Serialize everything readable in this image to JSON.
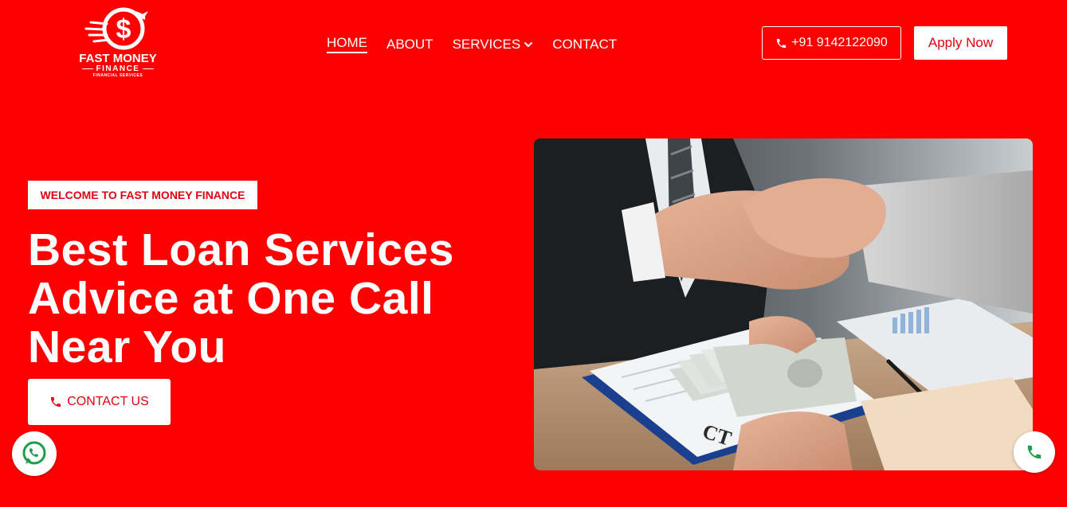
{
  "brand": {
    "name": "FAST MONEY",
    "sub": "FINANCE",
    "tagline": "FINANCIAL SERVICES"
  },
  "nav": {
    "items": [
      {
        "label": "HOME",
        "active": true
      },
      {
        "label": "ABOUT"
      },
      {
        "label": "SERVICES",
        "has_dropdown": true
      },
      {
        "label": "CONTACT"
      }
    ]
  },
  "header": {
    "phone": "+91 9142122090",
    "apply_label": "Apply Now"
  },
  "hero": {
    "badge": "WELCOME TO FAST MONEY FINANCE",
    "headline_lines": [
      "Best Loan Services",
      "Advice at One Call",
      "Near You"
    ],
    "contact_label": "CONTACT US",
    "image_icon": "handshake-money-photo"
  },
  "floating": {
    "whatsapp_icon": "whatsapp-icon",
    "call_icon": "phone-icon"
  },
  "colors": {
    "brand_red": "#ff0000",
    "button_text_red": "#e3000f",
    "white": "#ffffff",
    "whatsapp_green": "#1e9e4a",
    "call_green": "#1e9e4a"
  }
}
